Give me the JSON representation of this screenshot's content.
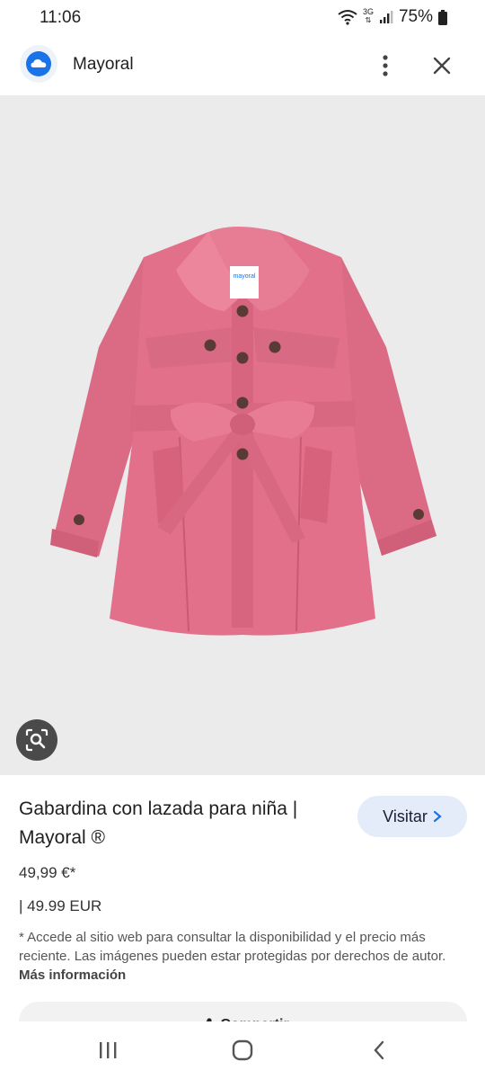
{
  "status_bar": {
    "time": "11:06",
    "network": "3G",
    "battery": "75%"
  },
  "header": {
    "site_name": "Mayoral",
    "logo_icon": "cloud-icon",
    "menu_icon": "more-vert-icon",
    "close_icon": "close-icon"
  },
  "product": {
    "title": "Gabardina con lazada para niña | Mayoral ®",
    "price_primary": "49,99 €*",
    "price_secondary": "| 49.99 EUR",
    "label_brand": "mayoral",
    "disclaimer": "* Accede al sitio web para consultar la disponibilidad y el precio más reciente. Las imágenes pueden estar protegidas por derechos de autor.",
    "more_info": "Más información",
    "coat_color": "#e2708a"
  },
  "actions": {
    "visit_label": "Visitar",
    "share_label": "Compartir"
  },
  "colors": {
    "visit_bg": "#e4ecfa",
    "image_bg": "#ebebeb",
    "logo_blue": "#1a73e8"
  }
}
